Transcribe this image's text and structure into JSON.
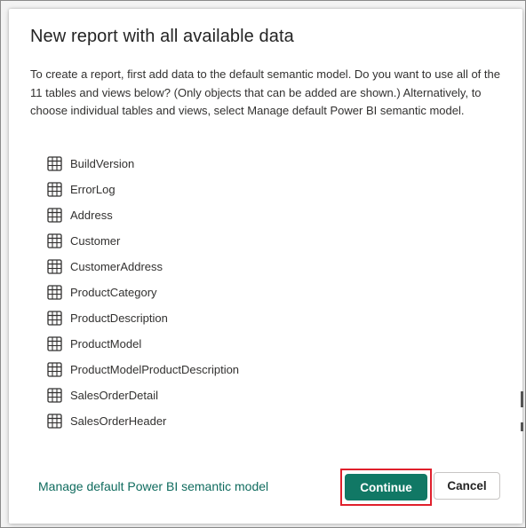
{
  "dialog": {
    "title": "New report with all available data",
    "description": "To create a report, first add data to the default semantic model. Do you want to use all of the 11 tables and views below? (Only objects that can be added are shown.) Alternatively, to choose individual tables and views, select Manage default Power BI semantic model.",
    "tables": [
      "BuildVersion",
      "ErrorLog",
      "Address",
      "Customer",
      "CustomerAddress",
      "ProductCategory",
      "ProductDescription",
      "ProductModel",
      "ProductModelProductDescription",
      "SalesOrderDetail",
      "SalesOrderHeader"
    ],
    "table_icon": "table-grid-icon",
    "manage_link": "Manage default Power BI semantic model",
    "continue_label": "Continue",
    "cancel_label": "Cancel"
  },
  "colors": {
    "primary": "#117865",
    "link": "#0f6b5e",
    "highlight": "#e0202c"
  }
}
